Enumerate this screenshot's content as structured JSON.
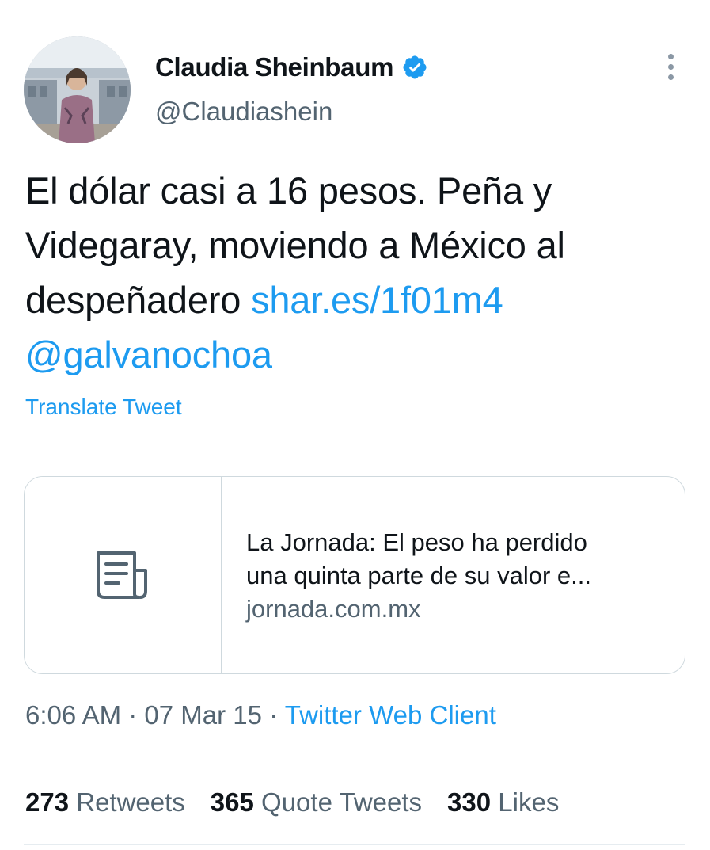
{
  "tweet": {
    "author_name": "Claudia Sheinbaum",
    "handle": "@Claudiashein",
    "verified": true,
    "text_line1": "El dólar casi a 16 pesos. Peña y",
    "text_line2": "Videgaray, moviendo a México al",
    "text_line3_plain": "despeñadero ",
    "link": "shar.es/1f01m4",
    "mention": "@galvanochoa",
    "translate_label": "Translate Tweet",
    "card": {
      "title_line1": "La Jornada: El peso ha perdido",
      "title_line2": "una quinta parte de su valor e...",
      "domain": "jornada.com.mx",
      "icon": "article-icon"
    },
    "time": "6:06 AM",
    "separator": " · ",
    "date": "07 Mar 15",
    "source": "Twitter Web Client",
    "stats": {
      "retweets_count": "273",
      "retweets_label": "Retweets",
      "quotes_count": "365",
      "quotes_label": "Quote Tweets",
      "likes_count": "330",
      "likes_label": "Likes"
    }
  },
  "colors": {
    "accent": "#1d9bf0",
    "text": "#0f1419",
    "muted": "#536471",
    "border": "#cfd9de"
  }
}
